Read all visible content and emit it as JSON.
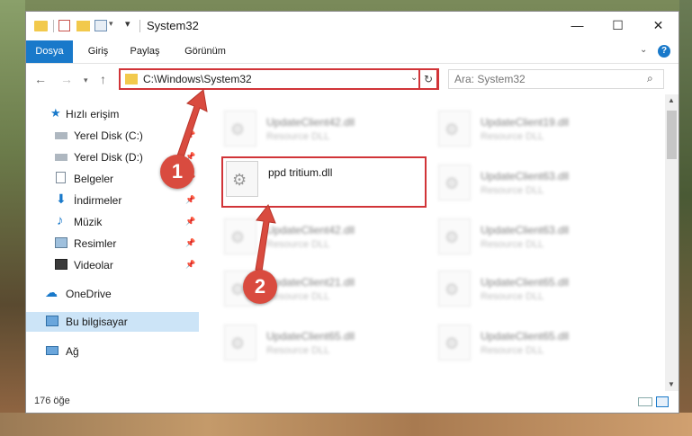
{
  "window": {
    "title": "System32",
    "controls": {
      "minimize": "—",
      "maximize": "☐",
      "close": "✕"
    }
  },
  "ribbon": {
    "tabs": [
      "Dosya",
      "Giriş",
      "Paylaş",
      "Görünüm"
    ],
    "accent": "#1979ca",
    "help": "?"
  },
  "address": {
    "path": "C:\\Windows\\System32",
    "search_placeholder": "Ara: System32"
  },
  "navpane": {
    "items": [
      {
        "label": "Hızlı erişim"
      },
      {
        "label": "Yerel Disk (C:)"
      },
      {
        "label": "Yerel Disk (D:)"
      },
      {
        "label": "Belgeler"
      },
      {
        "label": "İndirmeler"
      },
      {
        "label": "Müzik"
      },
      {
        "label": "Resimler"
      },
      {
        "label": "Videolar"
      },
      {
        "label": "OneDrive"
      },
      {
        "label": "Bu bilgisayar"
      },
      {
        "label": "Ağ"
      }
    ]
  },
  "files": {
    "highlighted": {
      "name": "ppd tritium.dll"
    },
    "type": "Resource DLL",
    "blurred": [
      "UpdateClient42.dll",
      "UpdateClient19.dll",
      "UpdateClient63.dll",
      "UpdateClient42.dll",
      "UpdateClient63.dll",
      "UpdateClient21.dll",
      "UpdateClient65.dll",
      "UpdateClient65.dll",
      "UpdateClient65.dll"
    ]
  },
  "status": {
    "count": "176 öğe"
  },
  "markers": {
    "step1": "1",
    "step2": "2",
    "color": "#d94b3f",
    "highlight_color": "#d13438"
  }
}
